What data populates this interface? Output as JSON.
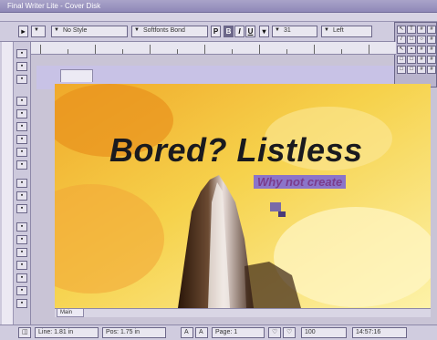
{
  "window": {
    "title": "Final Writer Lite - Cover Disk"
  },
  "toolbar": {
    "style_select": "No Style",
    "font_select": "Softfonts Bond",
    "bold": "B",
    "italic": "I",
    "underline": "U",
    "size_select": "31",
    "align_select": "Left"
  },
  "document": {
    "headline": "Bored? Listless",
    "subtext": "Why not create",
    "tab_label": "",
    "master_tab": "Main"
  },
  "status": {
    "line": "Line: 1.81 in",
    "pos": "Pos: 1.75 in",
    "page": "Page: 1",
    "zoom": "100",
    "time": "14:57:16"
  },
  "colors": {
    "accent": "#8b74c9",
    "canvas_bg": "#f5e06a",
    "chrome": "#c9c4d6"
  }
}
